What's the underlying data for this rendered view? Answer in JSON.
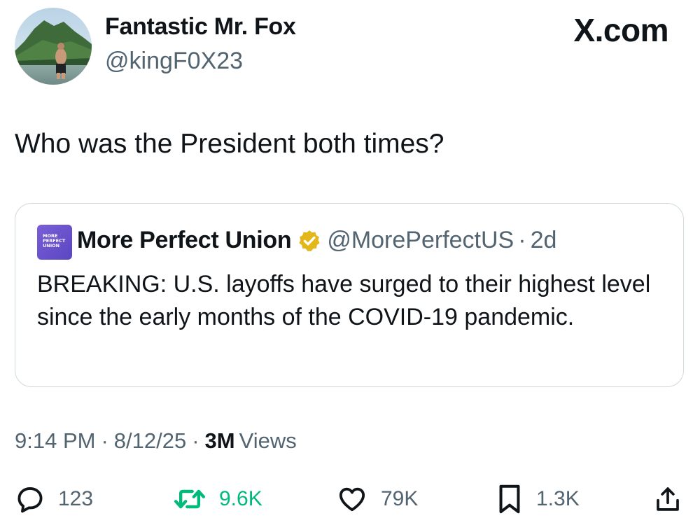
{
  "author": {
    "display_name": "Fantastic Mr. Fox",
    "handle": "@kingF0X23",
    "avatar_icon": "profile-photo"
  },
  "site_mark": "X.com",
  "tweet": {
    "text": "Who was the President both times?"
  },
  "quoted": {
    "logo_icon": "more-perfect-union-logo",
    "logo_lines": [
      "MORE",
      "PERFECT",
      "UNION"
    ],
    "name": "More Perfect Union",
    "verified_icon": "gold-verified-badge-icon",
    "handle": "@MorePerfectUS",
    "separator": "·",
    "time": "2d",
    "text": "BREAKING: U.S. layoffs have surged to their highest level since the early months of the COVID-19 pandemic."
  },
  "meta": {
    "time": "9:14 PM",
    "date": "8/12/25",
    "separator": "·",
    "views_count": "3M",
    "views_label": "Views"
  },
  "actions": {
    "reply": {
      "icon": "reply-icon",
      "count": "123"
    },
    "retweet": {
      "icon": "retweet-icon",
      "count": "9.6K"
    },
    "like": {
      "icon": "heart-icon",
      "count": "79K"
    },
    "bookmark": {
      "icon": "bookmark-icon",
      "count": "1.3K"
    },
    "share": {
      "icon": "share-icon"
    }
  },
  "colors": {
    "text_primary": "#0f1419",
    "text_secondary": "#536471",
    "retweet_green": "#00ba7c",
    "border": "#cfd9de",
    "verified_gold": "#e2b719",
    "logo_purple": "#6a52cc"
  }
}
